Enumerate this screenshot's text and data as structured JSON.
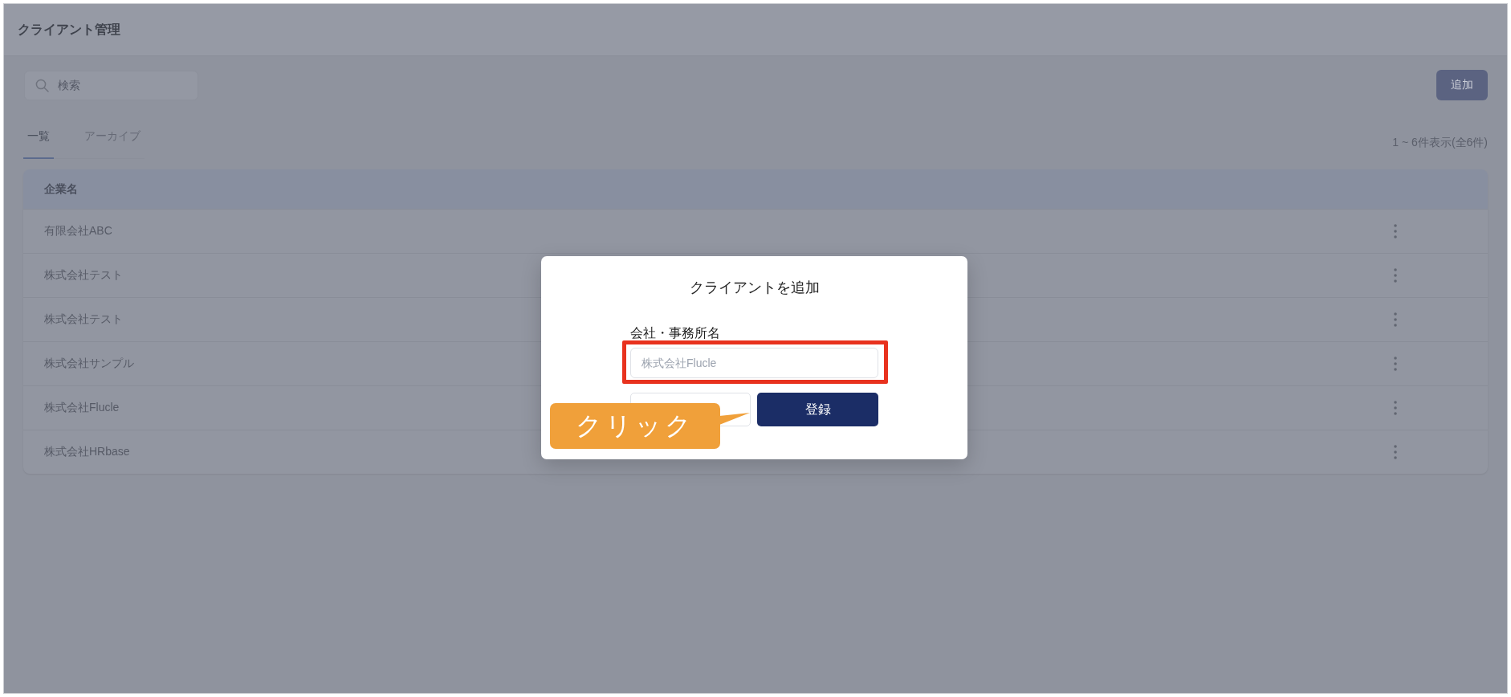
{
  "header": {
    "title": "クライアント管理"
  },
  "toolbar": {
    "search": {
      "placeholder": "検索"
    },
    "add_button": {
      "label": "追加"
    }
  },
  "tabs": [
    {
      "label": "一覧",
      "selected": true
    },
    {
      "label": "アーカイブ",
      "selected": false
    }
  ],
  "result_count": "1 ~ 6件表示(全6件)",
  "table": {
    "columns": [
      "企業名"
    ],
    "rows": [
      {
        "company": "有限会社ABC"
      },
      {
        "company": "株式会社テスト"
      },
      {
        "company": "株式会社テスト"
      },
      {
        "company": "株式会社サンプル"
      },
      {
        "company": "株式会社Flucle"
      },
      {
        "company": "株式会社HRbase"
      }
    ]
  },
  "dialog": {
    "title": "クライアントを追加",
    "field": {
      "label": "会社・事務所名",
      "placeholder": "株式会社Flucle",
      "highlighted": true
    },
    "buttons": [
      {
        "kind": "secondary"
      },
      {
        "kind": "primary",
        "label": "登録"
      }
    ]
  },
  "annotations": [
    {
      "kind": "callout",
      "text": "クリック"
    }
  ]
}
